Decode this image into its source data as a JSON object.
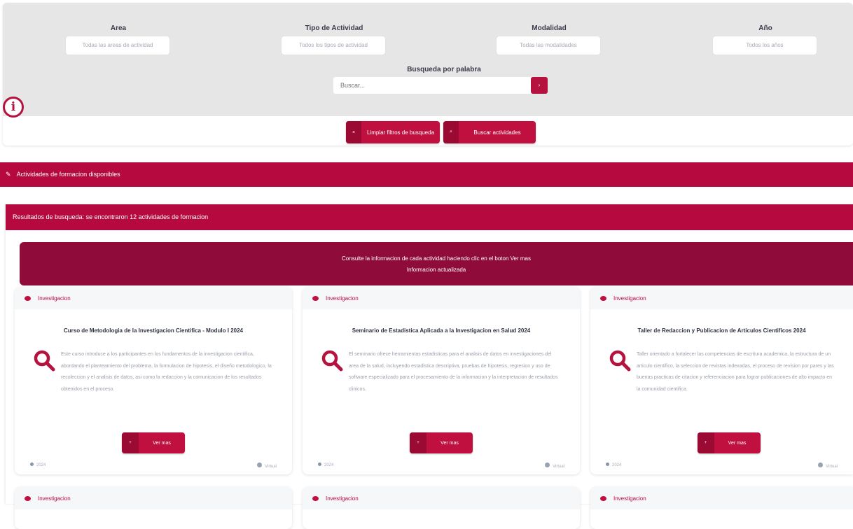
{
  "filters": [
    {
      "label": "Area",
      "select": "Todas las areas de actividad"
    },
    {
      "label": "Tipo de Actividad",
      "select": "Todos los tipos de actividad"
    },
    {
      "label": "Modalidad",
      "select": "Todas las modalidades"
    },
    {
      "label": "Año",
      "select": "Todos los años"
    }
  ],
  "search": {
    "label": "Busqueda por palabra",
    "placeholder": "Buscar...",
    "button": "›"
  },
  "info_icon": "i",
  "actions": [
    {
      "label": "Limpiar filtros de busqueda",
      "icon": "×"
    },
    {
      "label": "Buscar actividades",
      "icon": "⌕"
    }
  ],
  "banner": {
    "icon": "✎",
    "text": "Actividades de formacion disponibles"
  },
  "results": {
    "header": "Resultados de busqueda: se encontraron 12 actividades de formacion",
    "banner_line1": "Consulte la informacion de cada actividad haciendo clic en el boton Ver mas",
    "banner_line2": "Informacion actualizada"
  },
  "cards": [
    {
      "category": "Investigacion",
      "title": "Curso de Metodologia de la Investigacion Cientifica - Modulo I 2024",
      "text": "Este curso introduce a los participantes en los fundamentos de la investigacion cientifica, abordando el planteamiento del problema, la formulacion de hipotesis, el diseño metodologico, la recoleccion y el analisis de datos, asi como la redaccion y la comunicacion de los resultados obtenidos en el proceso.",
      "button": "Ver mas",
      "foot_left": "2024",
      "foot_right": "Virtual"
    },
    {
      "category": "Investigacion",
      "title": "Seminario de Estadistica Aplicada a la Investigacion en Salud 2024",
      "text": "El seminario ofrece herramientas estadisticas para el analisis de datos en investigaciones del area de la salud, incluyendo estadistica descriptiva, pruebas de hipotesis, regresion y uso de software especializado para el procesamiento de la informacion y la interpretacion de resultados clinicos.",
      "button": "Ver mas",
      "foot_left": "2024",
      "foot_right": "Virtual"
    },
    {
      "category": "Investigacion",
      "title": "Taller de Redaccion y Publicacion de Articulos Cientificos 2024",
      "text": "Taller orientado a fortalecer las competencias de escritura academica, la estructura de un articulo cientifico, la seleccion de revistas indexadas, el proceso de revision por pares y las buenas practicas de citacion y referenciacion para lograr publicaciones de alto impacto en la comunidad cientifica.",
      "button": "Ver mas",
      "foot_left": "2024",
      "foot_right": "Virtual"
    },
    {
      "category": "Investigacion"
    },
    {
      "category": "Investigacion"
    },
    {
      "category": "Investigacion"
    }
  ]
}
